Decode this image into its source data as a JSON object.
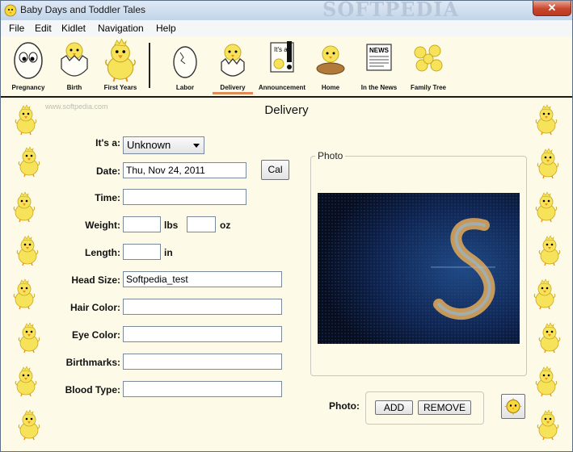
{
  "window": {
    "title": "Baby Days and Toddler Tales",
    "close_label": "✕",
    "watermark": "SOFTPEDIA"
  },
  "menu": [
    "File",
    "Edit",
    "Kidlet",
    "Navigation",
    "Help"
  ],
  "toolbar": {
    "group1": [
      "Pregnancy",
      "Birth",
      "First Years"
    ],
    "group2": [
      "Labor",
      "Delivery",
      "Announcement",
      "Home",
      "In the News",
      "Family Tree"
    ],
    "announcement_icon_text": "It's a",
    "news_icon_text": "NEWS"
  },
  "page": {
    "title": "Delivery",
    "site_watermark": "www.softpedia.com"
  },
  "form": {
    "its_a_label": "It's a:",
    "its_a_value": "Unknown",
    "date_label": "Date:",
    "date_value": "Thu, Nov 24, 2011",
    "cal_button": "Cal",
    "time_label": "Time:",
    "time_value": "",
    "weight_label": "Weight:",
    "weight_lbs_value": "",
    "weight_lbs_unit": "lbs",
    "weight_oz_value": "",
    "weight_oz_unit": "oz",
    "length_label": "Length:",
    "length_value": "",
    "length_unit": "in",
    "head_size_label": "Head Size:",
    "head_size_value": "Softpedia_test",
    "hair_color_label": "Hair Color:",
    "hair_color_value": "",
    "eye_color_label": "Eye Color:",
    "eye_color_value": "",
    "birthmarks_label": "Birthmarks:",
    "birthmarks_value": "",
    "blood_type_label": "Blood Type:",
    "blood_type_value": ""
  },
  "photo": {
    "group_label": "Photo",
    "photo_label": "Photo:",
    "add_button": "ADD",
    "remove_button": "REMOVE"
  },
  "colors": {
    "background": "#fdfbe8",
    "active_underline": "#e08a5a",
    "chick_yellow": "#f7e35a"
  }
}
